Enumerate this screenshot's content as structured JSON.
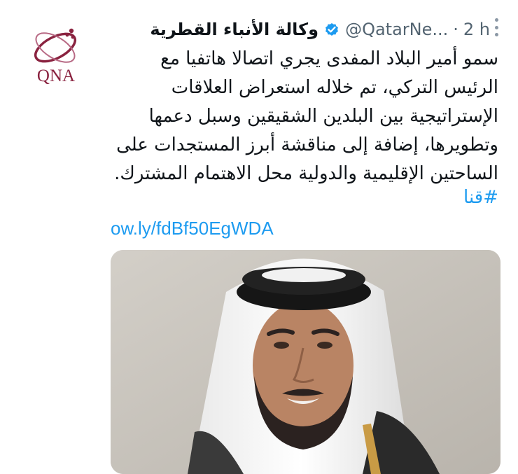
{
  "tweet": {
    "display_name": "وكالة الأنباء القطرية",
    "handle": "@QatarNe...",
    "separator": "·",
    "time": "2 h",
    "avatar_text": "QNA",
    "text_lines": [
      "سمو أمير البلاد المفدى يجري اتصالا هاتفيا مع",
      "الرئيس التركي، تم خلاله استعراض العلاقات",
      "الإستراتيجية بين البلدين الشقيقين وسبل دعمها",
      "وتطويرها، إضافة إلى مناقشة أبرز المستجدات على",
      "الساحتين الإقليمية والدولية محل الاهتمام المشترك."
    ],
    "hashtag": "#قنا",
    "link": "ow.ly/fdBf50EgWDA"
  },
  "colors": {
    "link": "#1d9bf0",
    "text": "#0f1419",
    "muted": "#536471",
    "brand": "#8a2340",
    "verified": "#1d9bf0"
  },
  "icons": [
    "qna-logo-icon",
    "verified-badge-icon",
    "more-options-icon"
  ]
}
